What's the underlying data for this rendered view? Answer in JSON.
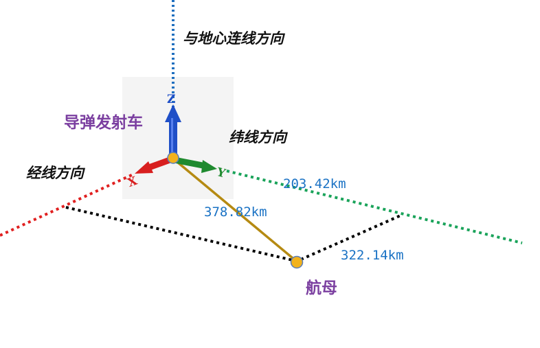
{
  "labels": {
    "vertical_direction": "与地心连线方向",
    "latitude_direction": "纬线方向",
    "longitude_direction": "经线方向",
    "launcher": "导弹发射车",
    "carrier": "航母"
  },
  "axes": {
    "z": "Z",
    "x": "X",
    "y": "Y"
  },
  "distances": {
    "launcher_to_carrier": "378.82km",
    "along_latitude": "203.42km",
    "along_longitude": "322.14km"
  },
  "colors": {
    "vertical_line": "#1f6fbf",
    "latitude_line": "#1aa35a",
    "longitude_line": "#e02020",
    "projection_line": "#000000",
    "direct_line": "#b58a12",
    "node_fill": "#f2b21c",
    "node_label": "#7b3fa0",
    "distance_label": "#1a72c4",
    "z_axis": "#1f4fc7",
    "x_axis": "#d81f1f",
    "y_axis": "#1f8a2f"
  }
}
